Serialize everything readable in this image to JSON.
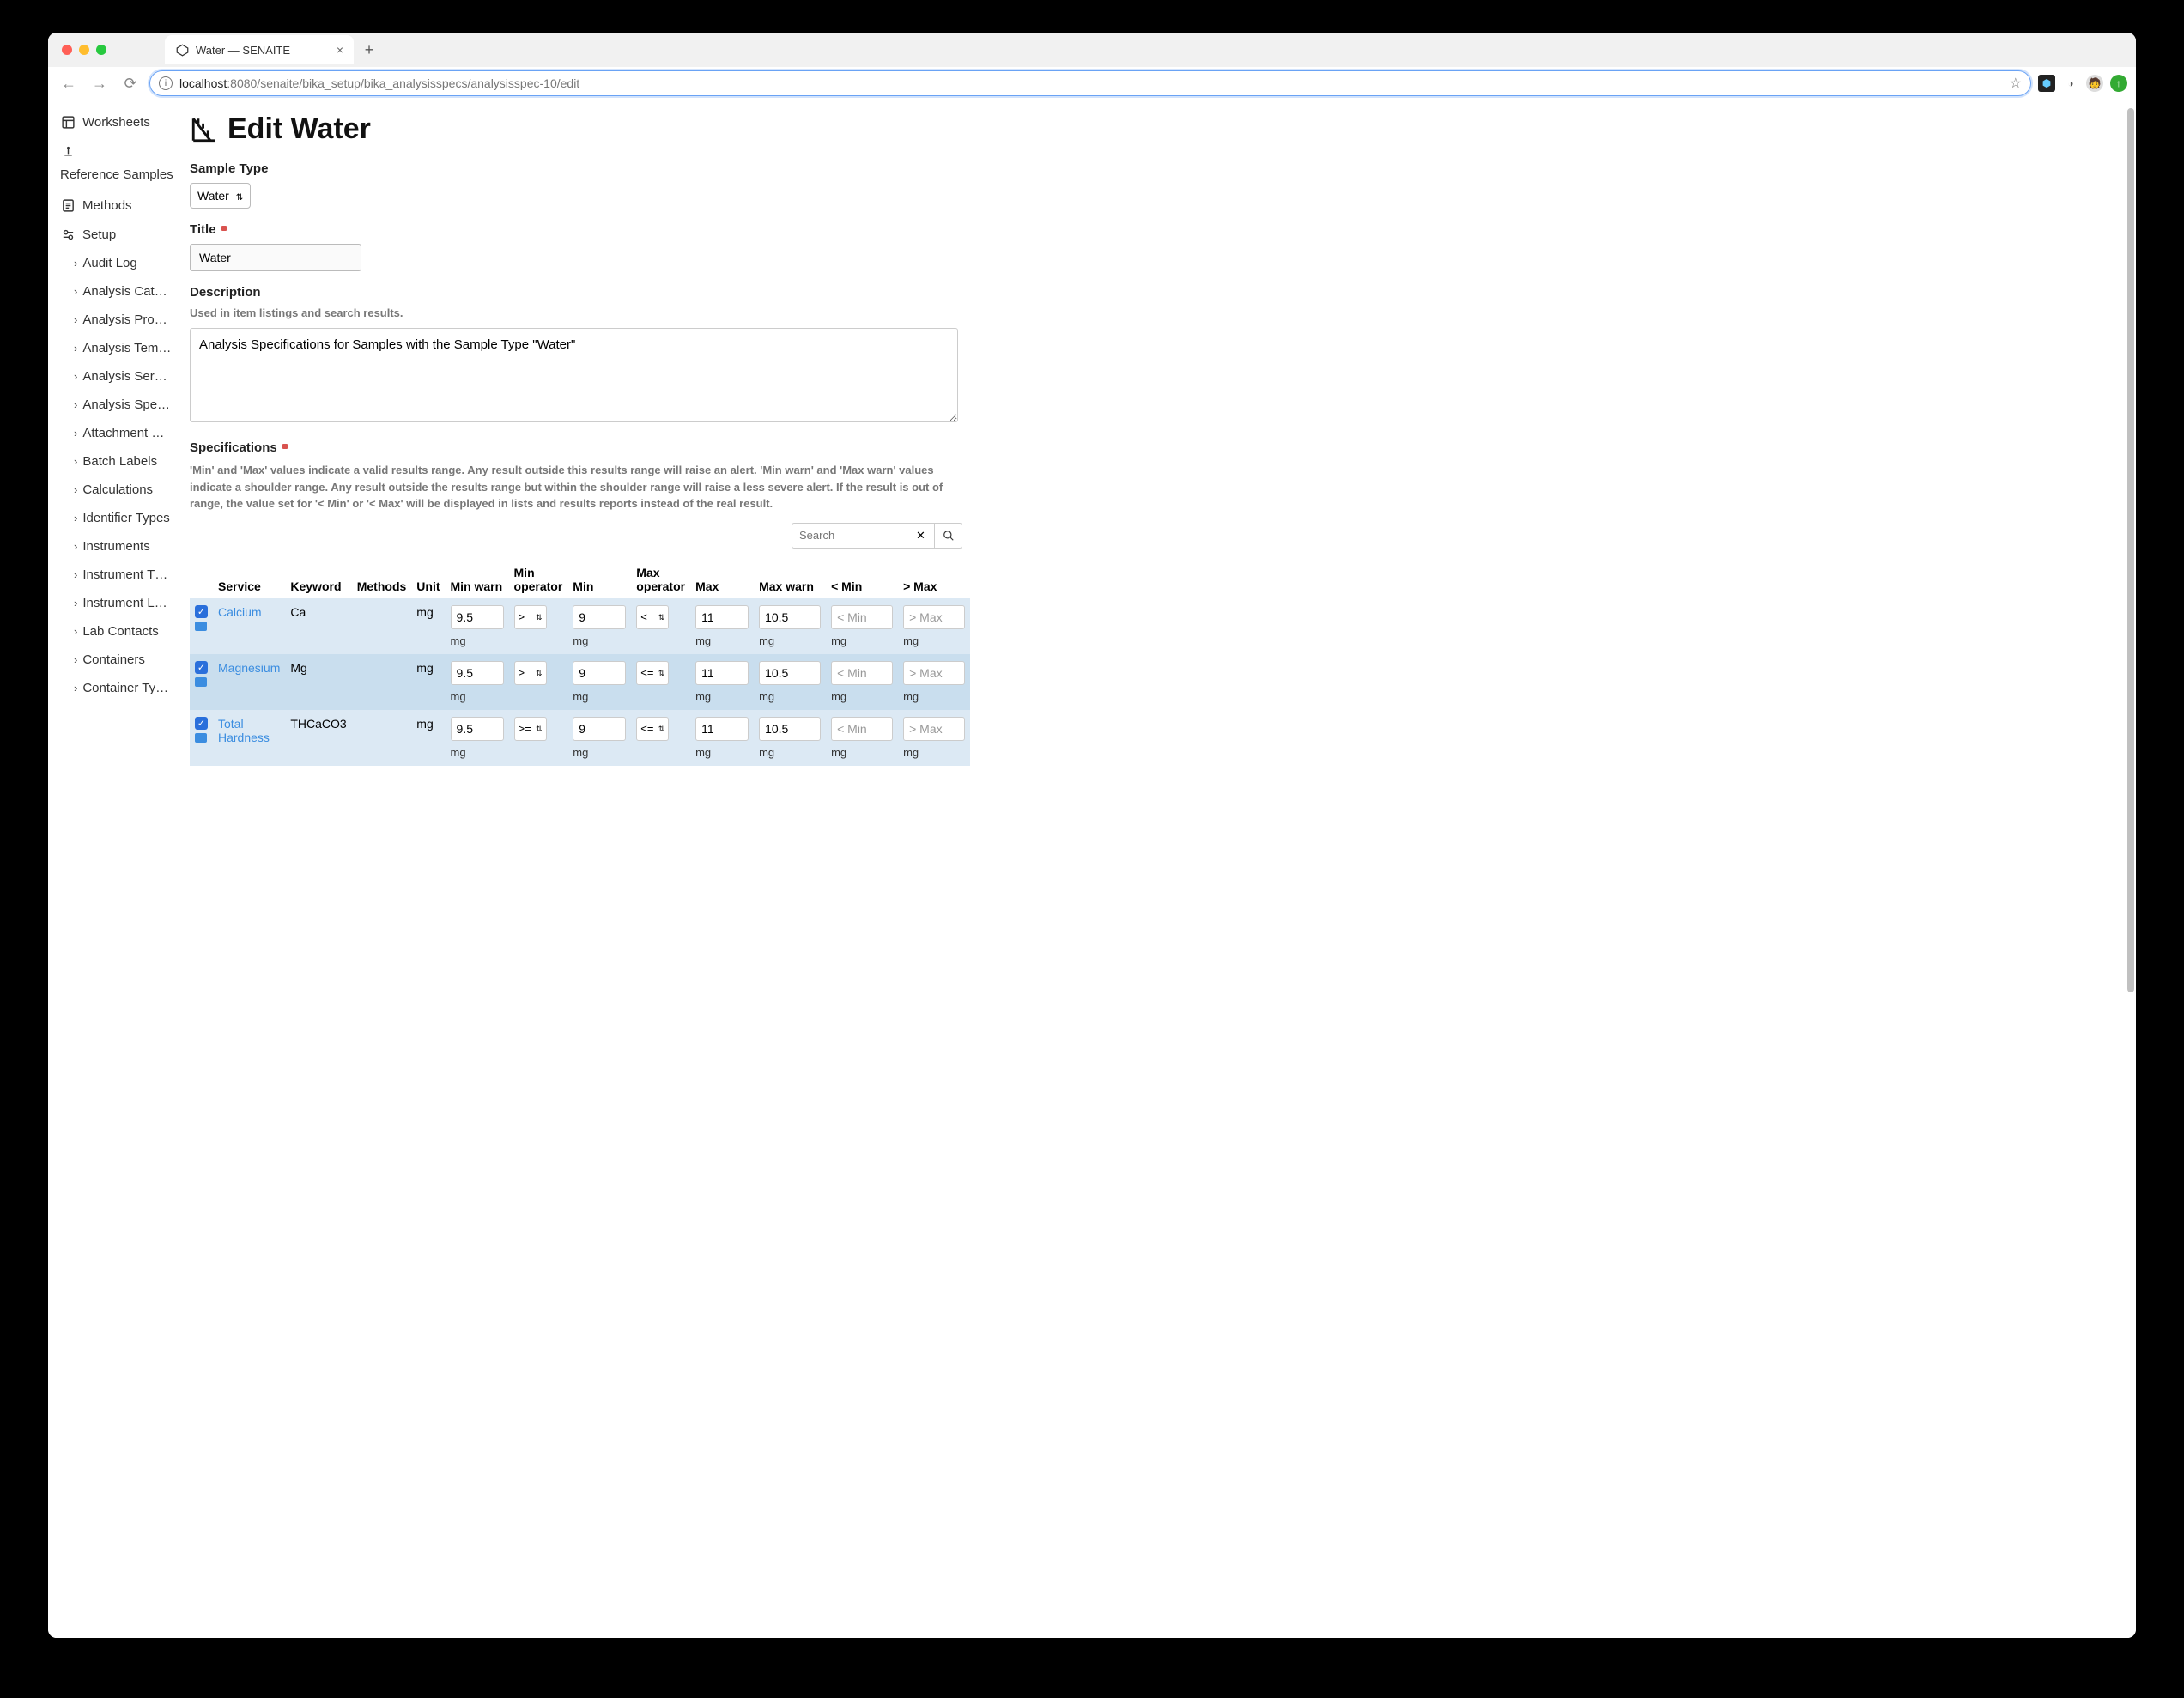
{
  "browser": {
    "tab_title": "Water — SENAITE",
    "url_host": "localhost",
    "url_rest": ":8080/senaite/bika_setup/bika_analysisspecs/analysisspec-10/edit"
  },
  "sidebar": {
    "items": [
      {
        "icon": "worksheets",
        "label": "Worksheets"
      },
      {
        "icon": "refsamples",
        "label": "Reference Samples"
      },
      {
        "icon": "methods",
        "label": "Methods"
      },
      {
        "icon": "setup",
        "label": "Setup"
      }
    ],
    "setup_children": [
      "Audit Log",
      "Analysis Cat…",
      "Analysis Pro…",
      "Analysis Tem…",
      "Analysis Ser…",
      "Analysis Spe…",
      "Attachment …",
      "Batch Labels",
      "Calculations",
      "Identifier Types",
      "Instruments",
      "Instrument T…",
      "Instrument L…",
      "Lab Contacts",
      "Containers",
      "Container Ty…"
    ]
  },
  "page": {
    "title": "Edit Water",
    "sample_type_label": "Sample Type",
    "sample_type_value": "Water",
    "title_label": "Title",
    "title_value": "Water",
    "description_label": "Description",
    "description_help": "Used in item listings and search results.",
    "description_value": "Analysis Specifications for Samples with the Sample Type \"Water\"",
    "spec_label": "Specifications",
    "spec_help": "'Min' and 'Max' values indicate a valid results range. Any result outside this results range will raise an alert. 'Min warn' and 'Max warn' values indicate a shoulder range. Any result outside the results range but within the shoulder range will raise a less severe alert. If the result is out of range, the value set for '< Min' or '< Max' will be displayed in lists and results reports instead of the real result.",
    "search_placeholder": "Search"
  },
  "table": {
    "headers": {
      "service": "Service",
      "keyword": "Keyword",
      "methods": "Methods",
      "unit": "Unit",
      "min_warn": "Min warn",
      "min_op": "Min operator",
      "min": "Min",
      "max_op": "Max operator",
      "max": "Max",
      "max_warn": "Max warn",
      "lt_min": "< Min",
      "gt_max": "> Max"
    },
    "placeholders": {
      "lt_min": "< Min",
      "gt_max": "> Max"
    },
    "unit_under": "mg",
    "rows": [
      {
        "service": "Calcium",
        "keyword": "Ca",
        "unit": "mg",
        "min_warn": "9.5",
        "min_op": ">",
        "min": "9",
        "max_op": "<",
        "max": "11",
        "max_warn": "10.5"
      },
      {
        "service": "Magnesium",
        "keyword": "Mg",
        "unit": "mg",
        "min_warn": "9.5",
        "min_op": ">",
        "min": "9",
        "max_op": "<=",
        "max": "11",
        "max_warn": "10.5"
      },
      {
        "service": "Total Hardness",
        "keyword": "THCaCO3",
        "unit": "mg",
        "min_warn": "9.5",
        "min_op": ">=",
        "min": "9",
        "max_op": "<=",
        "max": "11",
        "max_warn": "10.5"
      }
    ]
  }
}
